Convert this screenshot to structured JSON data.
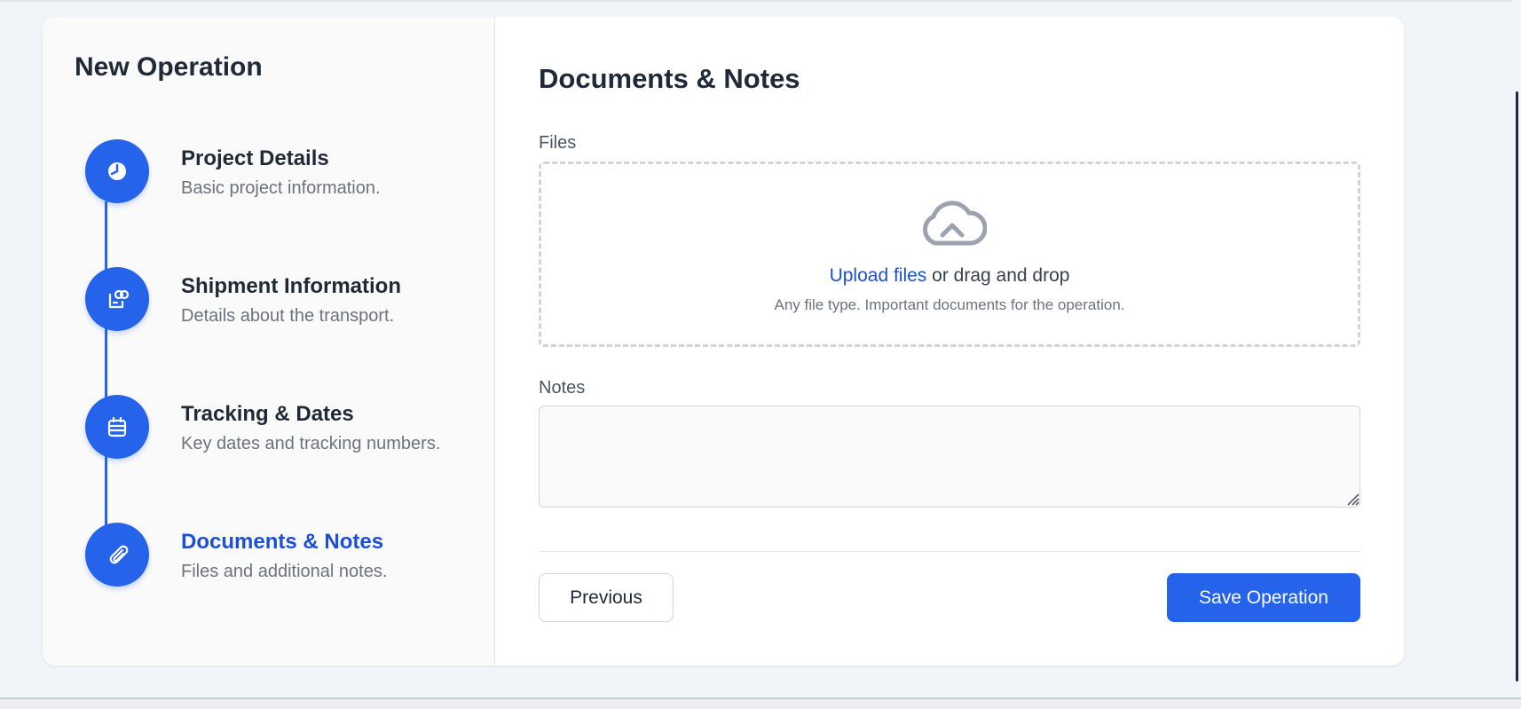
{
  "sidebar": {
    "title": "New Operation",
    "steps": [
      {
        "title": "Project Details",
        "description": "Basic project information.",
        "icon": "clock-icon",
        "active": false
      },
      {
        "title": "Shipment Information",
        "description": "Details about the transport.",
        "icon": "shipment-icon",
        "active": false
      },
      {
        "title": "Tracking & Dates",
        "description": "Key dates and tracking numbers.",
        "icon": "calendar-icon",
        "active": false
      },
      {
        "title": "Documents & Notes",
        "description": "Files and additional notes.",
        "icon": "paperclip-icon",
        "active": true
      }
    ]
  },
  "main": {
    "title": "Documents & Notes",
    "files_label": "Files",
    "dropzone": {
      "upload_link": "Upload files",
      "upload_rest": " or drag and drop",
      "hint": "Any file type. Important documents for the operation."
    },
    "notes_label": "Notes",
    "notes_value": "",
    "buttons": {
      "previous": "Previous",
      "save": "Save Operation"
    }
  },
  "colors": {
    "accent": "#2563eb",
    "active_text": "#1d4ed8",
    "background": "#f1f4f8"
  }
}
